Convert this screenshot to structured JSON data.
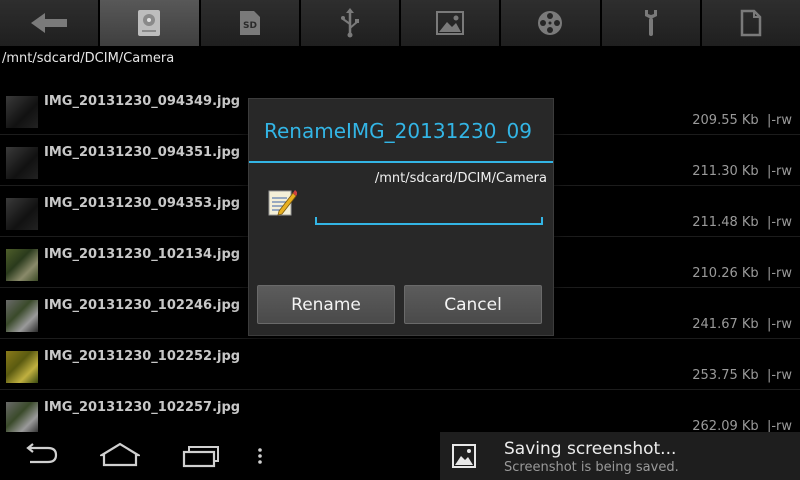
{
  "toolbar": {
    "buttons": [
      {
        "icon": "back-arrow-icon",
        "active": false
      },
      {
        "icon": "internal-storage-icon",
        "active": true
      },
      {
        "icon": "sd-card-icon",
        "label": "SD",
        "active": false
      },
      {
        "icon": "usb-icon",
        "active": false
      },
      {
        "icon": "image-icon",
        "active": false
      },
      {
        "icon": "film-reel-icon",
        "active": false
      },
      {
        "icon": "wrench-icon",
        "active": false
      },
      {
        "icon": "document-icon",
        "active": false
      }
    ]
  },
  "current_path": "/mnt/sdcard/DCIM/Camera",
  "files": [
    {
      "name": "IMG_20131230_094349.jpg",
      "size": "209.55 Kb",
      "perm": "|-rw",
      "thumb": "dark"
    },
    {
      "name": "IMG_20131230_094351.jpg",
      "size": "211.30 Kb",
      "perm": "|-rw",
      "thumb": "dark"
    },
    {
      "name": "IMG_20131230_094353.jpg",
      "size": "211.48 Kb",
      "perm": "|-rw",
      "thumb": "dark"
    },
    {
      "name": "IMG_20131230_102134.jpg",
      "size": "210.26 Kb",
      "perm": "|-rw",
      "thumb": "green"
    },
    {
      "name": "IMG_20131230_102246.jpg",
      "size": "241.67 Kb",
      "perm": "|-rw",
      "thumb": "mixed"
    },
    {
      "name": "IMG_20131230_102252.jpg",
      "size": "253.75 Kb",
      "perm": "|-rw",
      "thumb": "yellow"
    },
    {
      "name": "IMG_20131230_102257.jpg",
      "size": "262.09 Kb",
      "perm": "|-rw",
      "thumb": "mixed"
    }
  ],
  "dialog": {
    "title": "RenameIMG_20131230_09",
    "path": "/mnt/sdcard/DCIM/Camera",
    "input_value": "",
    "icon": "note-edit-icon",
    "rename_label": "Rename",
    "cancel_label": "Cancel"
  },
  "navbar": {
    "buttons": [
      "back-nav-icon",
      "home-nav-icon",
      "recent-apps-icon",
      "menu-dots-icon"
    ]
  },
  "notification": {
    "icon": "screenshot-image-icon",
    "title": "Saving screenshot...",
    "text": "Screenshot is being saved."
  },
  "colors": {
    "accent": "#33b5e5",
    "background": "#000000",
    "dialog_bg": "#282828"
  }
}
